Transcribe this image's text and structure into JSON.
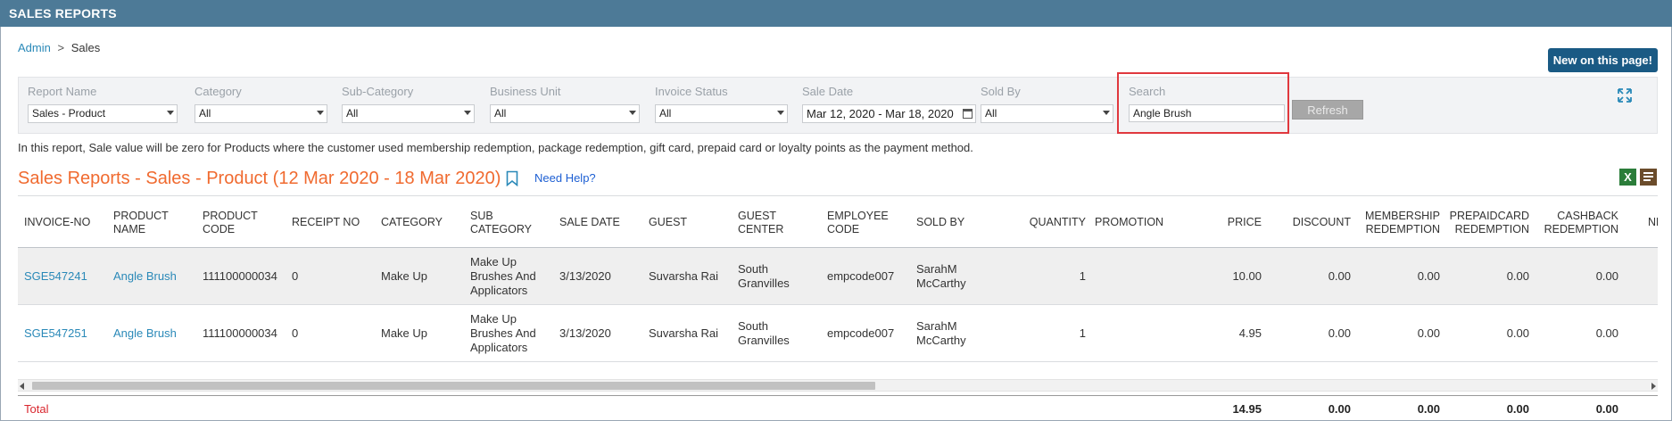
{
  "header": {
    "title": "SALES REPORTS"
  },
  "breadcrumb": {
    "root": "Admin",
    "separator": ">",
    "current": "Sales"
  },
  "new_button": "New on this page!",
  "filters": {
    "report_name": {
      "label": "Report Name",
      "value": "Sales - Product"
    },
    "category": {
      "label": "Category",
      "value": "All"
    },
    "sub_category": {
      "label": "Sub-Category",
      "value": "All"
    },
    "business_unit": {
      "label": "Business Unit",
      "value": "All"
    },
    "invoice_status": {
      "label": "Invoice Status",
      "value": "All"
    },
    "sale_date": {
      "label": "Sale Date",
      "value": "Mar 12, 2020 - Mar 18, 2020"
    },
    "sold_by": {
      "label": "Sold By",
      "value": "All"
    },
    "search": {
      "label": "Search",
      "value": "Angle Brush"
    },
    "refresh_label": "Refresh"
  },
  "note": "In this report, Sale value will be zero for Products where the customer used membership redemption, package redemption, gift card, prepaid card or loyalty points as the payment method.",
  "report": {
    "title": "Sales Reports - Sales - Product (12 Mar 2020 - 18 Mar 2020)",
    "help_label": "Need Help?",
    "excel_label": "X"
  },
  "table": {
    "columns": [
      "INVOICE-NO",
      "PRODUCT NAME",
      "PRODUCT CODE",
      "RECEIPT NO",
      "CATEGORY",
      "SUB CATEGORY",
      "SALE DATE",
      "GUEST",
      "GUEST CENTER",
      "EMPLOYEE CODE",
      "SOLD BY",
      "QUANTITY",
      "PROMOTION",
      "PRICE",
      "DISCOUNT",
      "MEMBERSHIP REDEMPTION",
      "PREPAIDCARD REDEMPTION",
      "CASHBACK REDEMPTION",
      "NE"
    ],
    "rows": [
      {
        "invoice": "SGE547241",
        "product_name": "Angle Brush",
        "product_code": "111100000034",
        "receipt": "0",
        "category": "Make Up",
        "sub_category": "Make Up Brushes And Applicators",
        "sale_date": "3/13/2020",
        "guest": "Suvarsha Rai",
        "guest_center": "South Granvilles",
        "employee_code": "empcode007",
        "sold_by": "SarahM McCarthy",
        "quantity": "1",
        "promotion": "",
        "price": "10.00",
        "discount": "0.00",
        "membership": "0.00",
        "prepaidcard": "0.00",
        "cashback": "0.00"
      },
      {
        "invoice": "SGE547251",
        "product_name": "Angle Brush",
        "product_code": "111100000034",
        "receipt": "0",
        "category": "Make Up",
        "sub_category": "Make Up Brushes And Applicators",
        "sale_date": "3/13/2020",
        "guest": "Suvarsha Rai",
        "guest_center": "South Granvilles",
        "employee_code": "empcode007",
        "sold_by": "SarahM McCarthy",
        "quantity": "1",
        "promotion": "",
        "price": "4.95",
        "discount": "0.00",
        "membership": "0.00",
        "prepaidcard": "0.00",
        "cashback": "0.00"
      }
    ],
    "totals": {
      "label": "Total",
      "price": "14.95",
      "discount": "0.00",
      "membership": "0.00",
      "prepaidcard": "0.00",
      "cashback": "0.00"
    }
  },
  "colors": {
    "header_bg": "#4d7a97",
    "title_orange": "#f06a2f",
    "link_blue": "#2a89b8",
    "highlight_red": "#e0383e",
    "total_red": "#d9262e"
  },
  "icons": [
    "expand-icon",
    "bookmark-icon",
    "excel-icon",
    "list-icon",
    "calendar-icon",
    "chevron-down-icon"
  ]
}
